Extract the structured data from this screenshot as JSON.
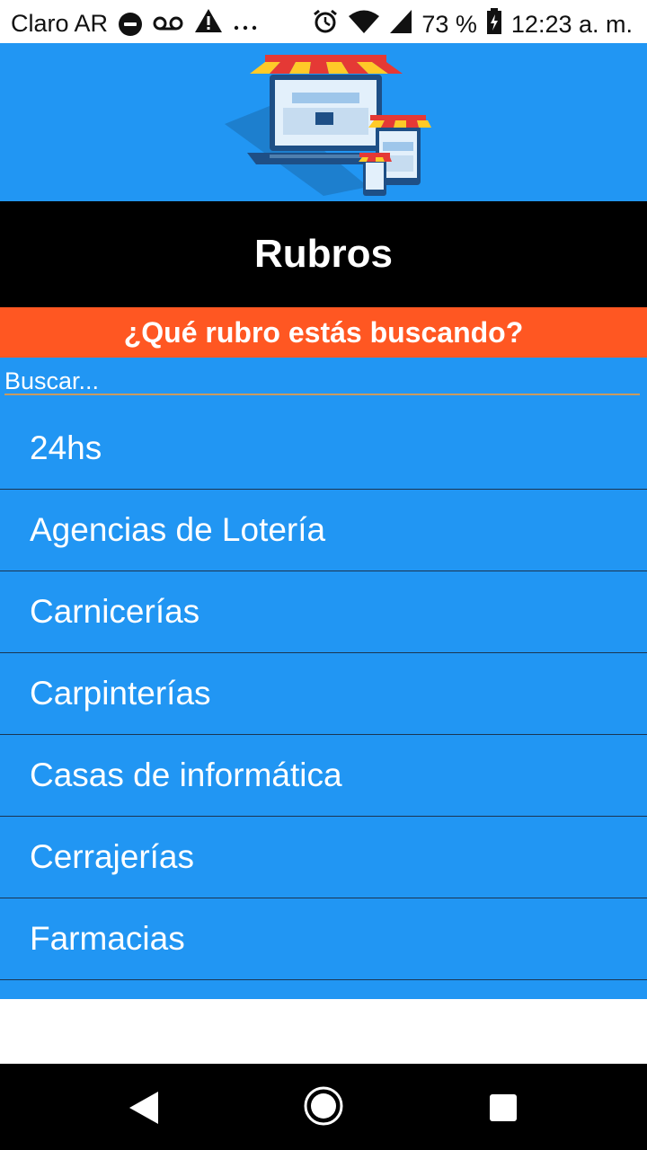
{
  "status_bar": {
    "carrier": "Claro AR",
    "battery": "73 %",
    "time": "12:23 a. m.",
    "icons": [
      "dnd-icon",
      "voicemail-icon",
      "warning-icon",
      "more-icon",
      "alarm-icon",
      "wifi-icon",
      "signal-icon",
      "battery-icon"
    ]
  },
  "header": {
    "title": "Rubros",
    "subtitle": "¿Qué rubro estás buscando?"
  },
  "search": {
    "placeholder": "Buscar..."
  },
  "list": {
    "items": [
      {
        "label": "24hs"
      },
      {
        "label": "Agencias de Lotería"
      },
      {
        "label": "Carnicerías"
      },
      {
        "label": "Carpinterías"
      },
      {
        "label": "Casas de informática"
      },
      {
        "label": "Cerrajerías"
      },
      {
        "label": "Farmacias"
      }
    ]
  },
  "colors": {
    "primary": "#2196f3",
    "accent": "#ff5722",
    "title_bg": "#000000"
  },
  "nav": {
    "icons": [
      "back-icon",
      "home-icon",
      "recents-icon"
    ]
  }
}
